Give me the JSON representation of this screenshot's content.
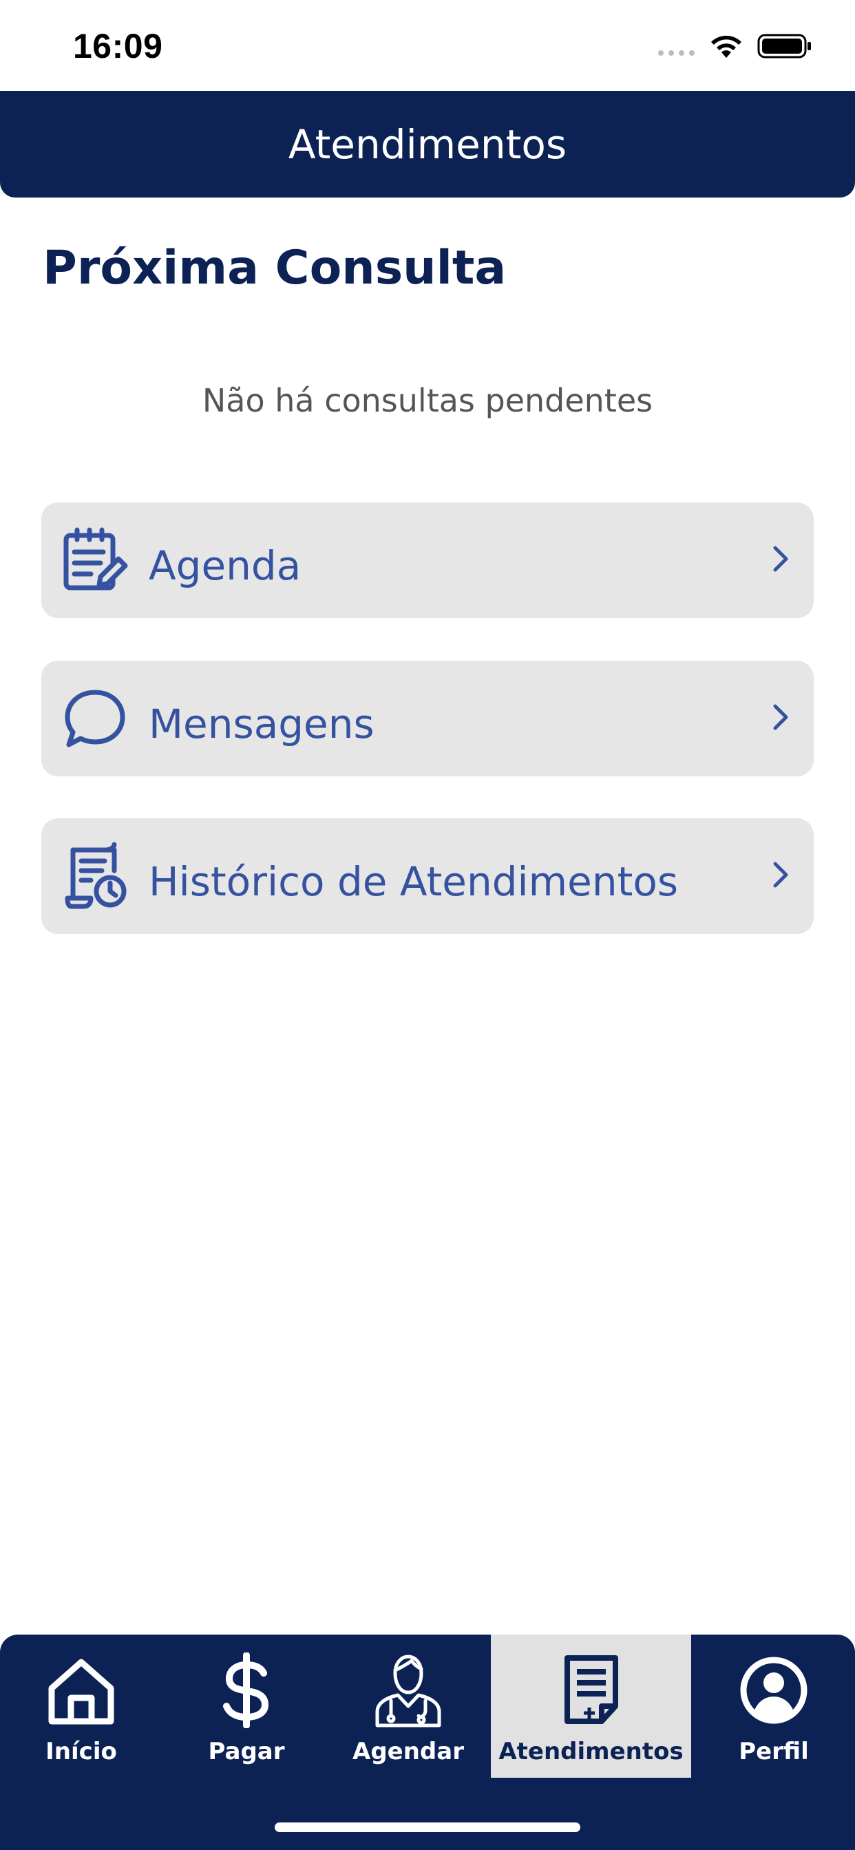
{
  "status_bar": {
    "time": "16:09"
  },
  "header": {
    "title": "Atendimentos"
  },
  "next_appointment": {
    "title": "Próxima Consulta",
    "empty_text": "Não há consultas pendentes"
  },
  "menu": [
    {
      "label": "Agenda",
      "icon": "calendar-edit-icon"
    },
    {
      "label": "Mensagens",
      "icon": "chat-bubble-icon"
    },
    {
      "label": "Histórico de Atendimentos",
      "icon": "history-document-icon"
    }
  ],
  "tabs": [
    {
      "label": "Início",
      "icon": "home-icon",
      "active": false
    },
    {
      "label": "Pagar",
      "icon": "dollar-icon",
      "active": false
    },
    {
      "label": "Agendar",
      "icon": "doctor-icon",
      "active": false
    },
    {
      "label": "Atendimentos",
      "icon": "medical-document-icon",
      "active": true
    },
    {
      "label": "Perfil",
      "icon": "profile-icon",
      "active": false
    }
  ],
  "colors": {
    "primary": "#0c2255",
    "accent": "#3552a1",
    "card_bg": "#e6e6e6",
    "active_tab_bg": "#e1e1e1"
  }
}
